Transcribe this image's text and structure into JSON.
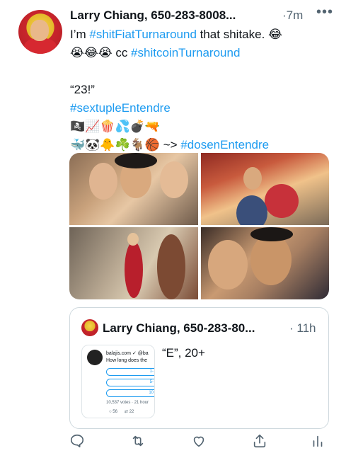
{
  "tweet": {
    "author": "Larry Chiang, 650-283-8008...",
    "time": "·7m",
    "more_icon": "•••",
    "lines": [
      [
        "I’m ",
        "#shitFiatTurnaround",
        " that shitake. ",
        "😂"
      ],
      [
        "😭😂😭",
        " cc ",
        "#shitcoinTurnaround"
      ],
      [],
      [
        "“23!”"
      ],
      [
        "#sextupleEntendre"
      ],
      [
        "🏴‍☠️📈🍿💦💣🔫"
      ],
      [
        "🐳🐼🐥☘️🐐🏀",
        " ~> ",
        "#dosenEntendre"
      ]
    ]
  },
  "quoted": {
    "author": "Larry Chiang, 650-283-80...",
    "time": "· 11h",
    "text": "“E”, 20+",
    "embed": {
      "handle": "balajis.com ✓ @ba",
      "question": "How long does the",
      "options": [
        "1-",
        "5-",
        "10"
      ],
      "votes": "10,537 votes · 21 hour",
      "replies": "56",
      "retweets": "22"
    }
  },
  "colors": {
    "link": "#1d9bf0",
    "muted": "#536471",
    "border": "#cfd9de"
  }
}
